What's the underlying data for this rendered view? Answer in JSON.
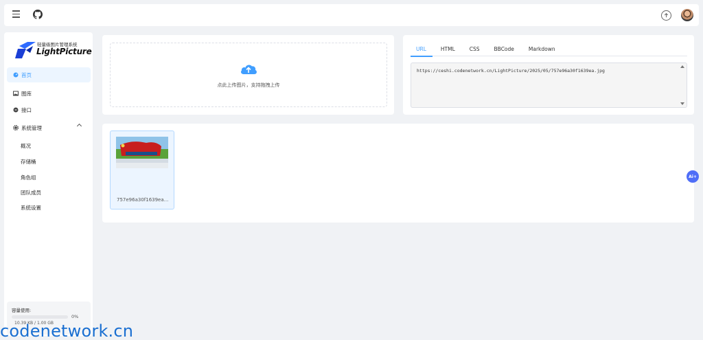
{
  "sidebar": {
    "logo": {
      "subtitle": "轻量级图片管理系统",
      "title": "LightPicture"
    },
    "items": [
      {
        "label": "首页"
      },
      {
        "label": "图库"
      },
      {
        "label": "接口"
      },
      {
        "label": "系统管理"
      }
    ],
    "submenu": [
      {
        "label": "概况"
      },
      {
        "label": "存储桶"
      },
      {
        "label": "角色组"
      },
      {
        "label": "团队成员"
      },
      {
        "label": "系统设置"
      }
    ],
    "storage": {
      "label": "容量使用:",
      "percent": "0%",
      "capacity": "10.39 KB / 1.00 GB",
      "fill_percent": 0
    }
  },
  "upload": {
    "hint": "点此上传图片，支持拖拽上传"
  },
  "link_panel": {
    "tabs": [
      "URL",
      "HTML",
      "CSS",
      "BBCode",
      "Markdown"
    ],
    "active_tab": "URL",
    "url": "https://ceshi.codenetwork.cn/LightPicture/2025/05/757e96a30f1639ea.jpg"
  },
  "gallery": {
    "items": [
      {
        "filename": "757e96a30f1639ea..."
      }
    ]
  },
  "floating": {
    "ai_label": "Ai+"
  },
  "watermark": "codenetwork.cn",
  "colors": {
    "accent": "#409eff",
    "ai_badge": "#4f6ef7",
    "watermark": "#1a6fd1"
  }
}
